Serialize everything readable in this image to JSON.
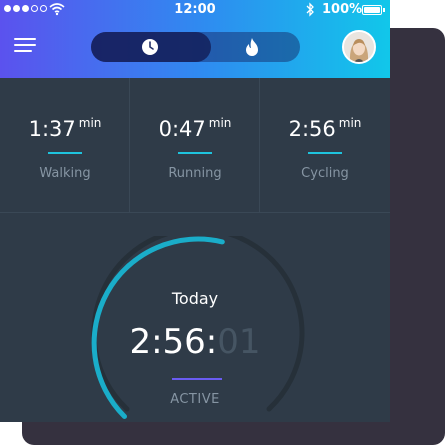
{
  "status_bar": {
    "signal_dots": 5,
    "signal_filled": 3,
    "time": "12:00",
    "battery": "100%"
  },
  "header": {
    "menu_icon": "hamburger-icon",
    "tabs": [
      {
        "icon": "clock-icon",
        "selected": true
      },
      {
        "icon": "flame-icon",
        "selected": false
      }
    ],
    "avatar_icon": "user-avatar"
  },
  "stats": [
    {
      "value": "1:37",
      "unit": "min",
      "label": "Walking"
    },
    {
      "value": "0:47",
      "unit": "min",
      "label": "Running"
    },
    {
      "value": "2:56",
      "unit": "min",
      "label": "Cycling"
    }
  ],
  "activity": {
    "heading": "Today",
    "timer_main": "2:56:",
    "timer_dim": "01",
    "status": "ACTIVE",
    "progress_fraction": 0.55
  },
  "colors": {
    "header_gradient": [
      "#5b52ee",
      "#2f8bf0",
      "#11c7ea"
    ],
    "accent_cyan": "#1ec3dd",
    "accent_purple": "#6a5cf2",
    "panel": "#2f3b48",
    "back_card": "#35313f"
  }
}
